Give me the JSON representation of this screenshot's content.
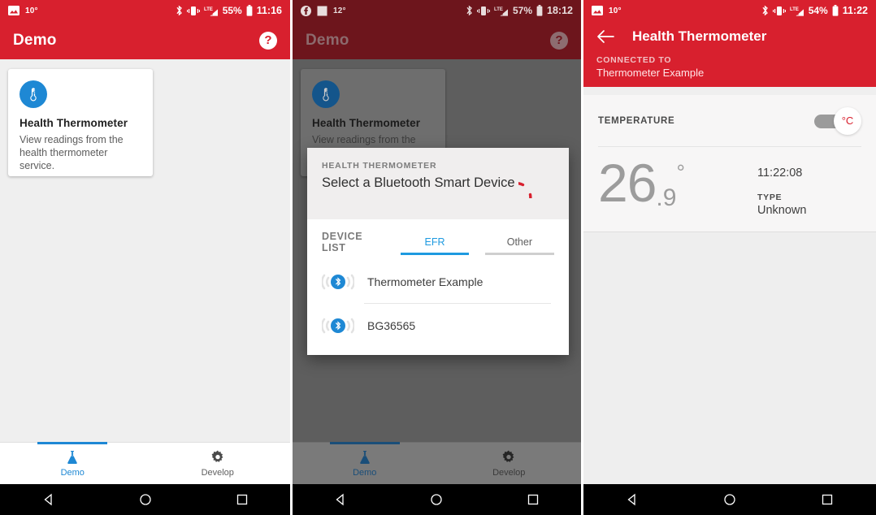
{
  "panel1": {
    "statusbar": {
      "temp": "10°",
      "battery_pct": "55%",
      "time": "11:16",
      "icons": [
        "image-icon",
        "bluetooth-icon",
        "vibrate-icon",
        "lte-signal-icon",
        "battery-icon"
      ]
    },
    "appbar": {
      "title": "Demo",
      "help_icon": "?",
      "bg_color": "#d8202e"
    },
    "card": {
      "icon": "thermometer-icon",
      "title": "Health Thermometer",
      "description": "View readings from the health thermometer service.",
      "icon_color": "#1e88d4"
    },
    "bottomnav": {
      "items": [
        {
          "label": "Demo",
          "icon": "flask-icon",
          "active": true
        },
        {
          "label": "Develop",
          "icon": "gear-icon",
          "active": false
        }
      ],
      "accent_color": "#1e88d4"
    },
    "sysnav": {
      "back": "back-triangle-icon",
      "home": "home-circle-icon",
      "recents": "recents-square-icon"
    }
  },
  "panel2": {
    "statusbar": {
      "temp": "12°",
      "battery_pct": "57%",
      "time": "18:12",
      "icons": [
        "facebook-icon",
        "white-square-icon",
        "bluetooth-icon",
        "vibrate-icon",
        "lte-signal-icon",
        "battery-icon"
      ]
    },
    "appbar": {
      "title": "Demo",
      "help_icon": "?",
      "bg_color": "#6d151c"
    },
    "card": {
      "icon": "thermometer-icon",
      "title": "Health Thermometer",
      "description": "View readings from the health thermometer service."
    },
    "dialog": {
      "eyebrow": "HEALTH THERMOMETER",
      "title": "Select a Bluetooth Smart Device",
      "spinner": "loading-spinner-icon",
      "spinner_color": "#d8202e",
      "list_label": "DEVICE LIST",
      "tabs": [
        {
          "label": "EFR",
          "active": true
        },
        {
          "label": "Other",
          "active": false
        }
      ],
      "devices": [
        {
          "name": "Thermometer Example",
          "icon": "bluetooth-device-icon"
        },
        {
          "name": "BG36565",
          "icon": "bluetooth-device-icon"
        }
      ]
    },
    "bottomnav": {
      "items": [
        {
          "label": "Demo",
          "icon": "flask-icon",
          "active": true
        },
        {
          "label": "Develop",
          "icon": "gear-icon",
          "active": false
        }
      ]
    }
  },
  "panel3": {
    "statusbar": {
      "temp": "10°",
      "battery_pct": "54%",
      "time": "11:22",
      "icons": [
        "image-icon",
        "bluetooth-icon",
        "vibrate-icon",
        "lte-signal-icon",
        "battery-icon"
      ]
    },
    "appbar": {
      "back_icon": "back-arrow-icon",
      "title": "Health Thermometer",
      "connected_label": "CONNECTED TO",
      "connected_name": "Thermometer Example",
      "bg_color": "#d8202e"
    },
    "temperature_card": {
      "section_label": "TEMPERATURE",
      "unit_toggle": {
        "unit": "°C",
        "state": "off",
        "unit_color": "#d8202e"
      },
      "value_whole": "26",
      "value_fraction": ".9",
      "degree_symbol": "°",
      "timestamp": "11:22:08",
      "type_label": "TYPE",
      "type_value": "Unknown"
    },
    "sysnav": {
      "back": "back-triangle-icon",
      "home": "home-circle-icon",
      "recents": "recents-square-icon"
    }
  }
}
